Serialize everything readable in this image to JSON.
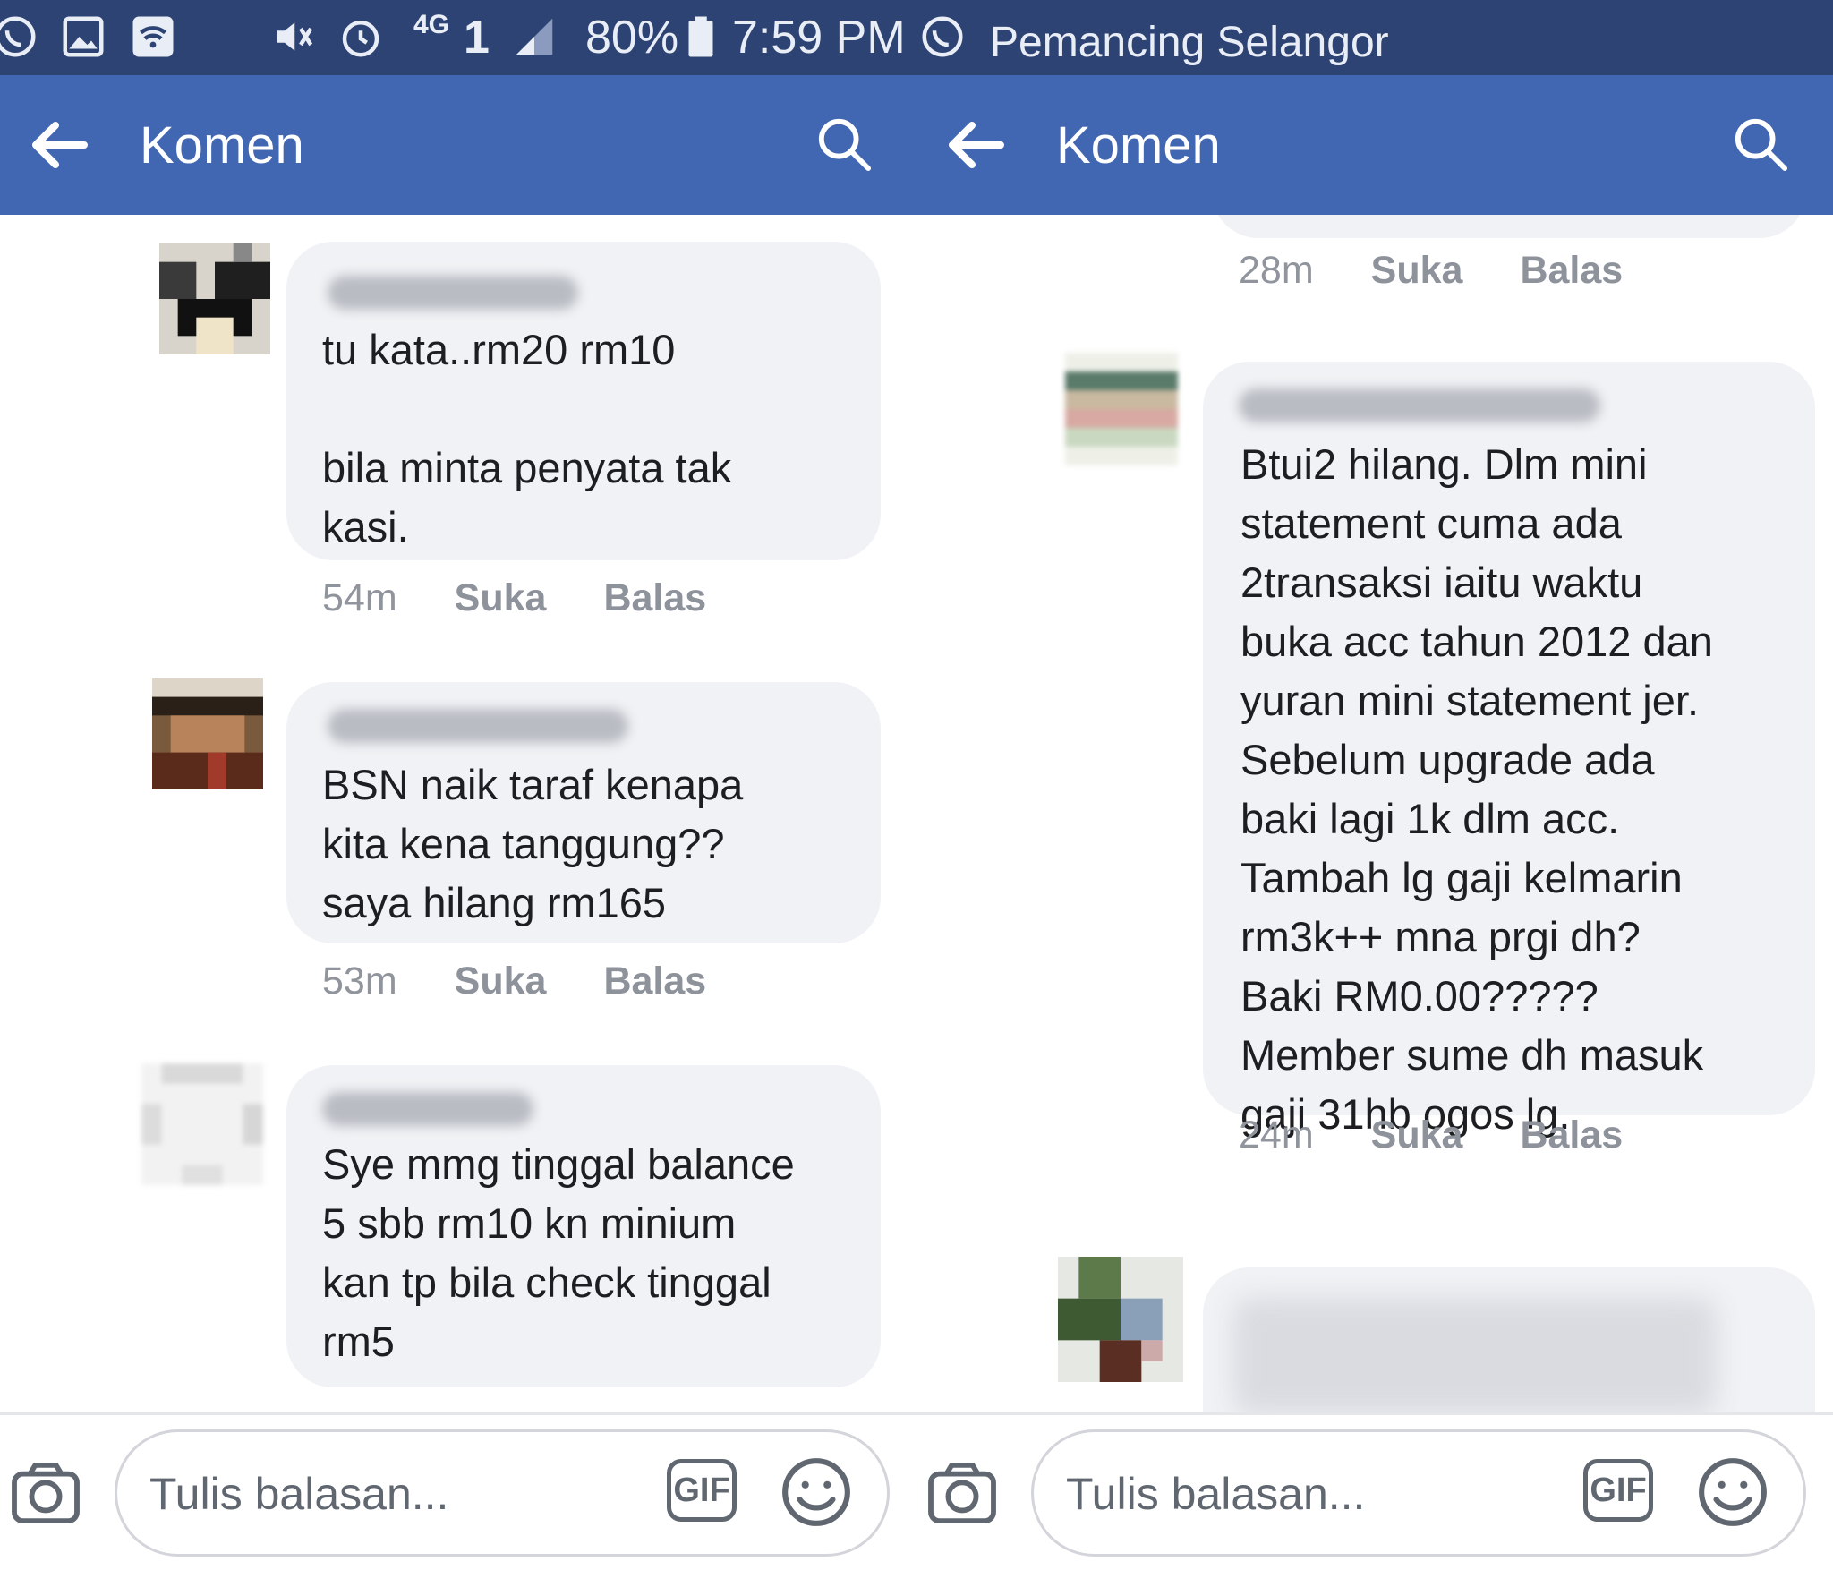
{
  "status_bar": {
    "battery": "80%",
    "time": "7:59 PM",
    "network": "4G",
    "sim": "1",
    "notification_app": "Pemancing Selangor"
  },
  "header": {
    "left_title": "Komen",
    "right_title": "Komen"
  },
  "left_comments": [
    {
      "text": "tu kata..rm20 rm10\n\nbila minta penyata tak\nkasi.",
      "time": "54m",
      "like": "Suka",
      "reply": "Balas"
    },
    {
      "text": "BSN naik taraf kenapa\nkita kena tanggung??\nsaya hilang rm165",
      "time": "53m",
      "like": "Suka",
      "reply": "Balas"
    },
    {
      "text": "Sye mmg tinggal balance\n5 sbb rm10 kn minium\nkan tp bila check tinggal\nrm5"
    }
  ],
  "right_comments": [
    {
      "time": "28m",
      "like": "Suka",
      "reply": "Balas"
    },
    {
      "text": "Btui2 hilang. Dlm mini\nstatement cuma ada\n2transaksi iaitu waktu\nbuka acc tahun 2012 dan\nyuran mini statement jer.\nSebelum upgrade ada\nbaki lagi 1k dlm acc.\nTambah lg gaji kelmarin\nrm3k++ mna prgi dh?\nBaki RM0.00?????\nMember sume dh masuk\ngaji 31hb ogos lg.",
      "time": "24m",
      "like": "Suka",
      "reply": "Balas"
    }
  ],
  "composer": {
    "placeholder_left": "Tulis balasan...",
    "placeholder_right": "Tulis balasan...",
    "gif_label": "GIF"
  },
  "icons": [
    "whatsapp-icon",
    "gallery-icon",
    "wifi-icon",
    "mute-icon",
    "alarm-icon",
    "signal-icon",
    "battery-icon",
    "back-arrow-icon",
    "search-icon",
    "camera-icon",
    "gif-icon",
    "emoji-icon"
  ],
  "colors": {
    "header": "#4267b2",
    "status_bar": "#2d4373",
    "bubble": "#f0f2f5"
  }
}
